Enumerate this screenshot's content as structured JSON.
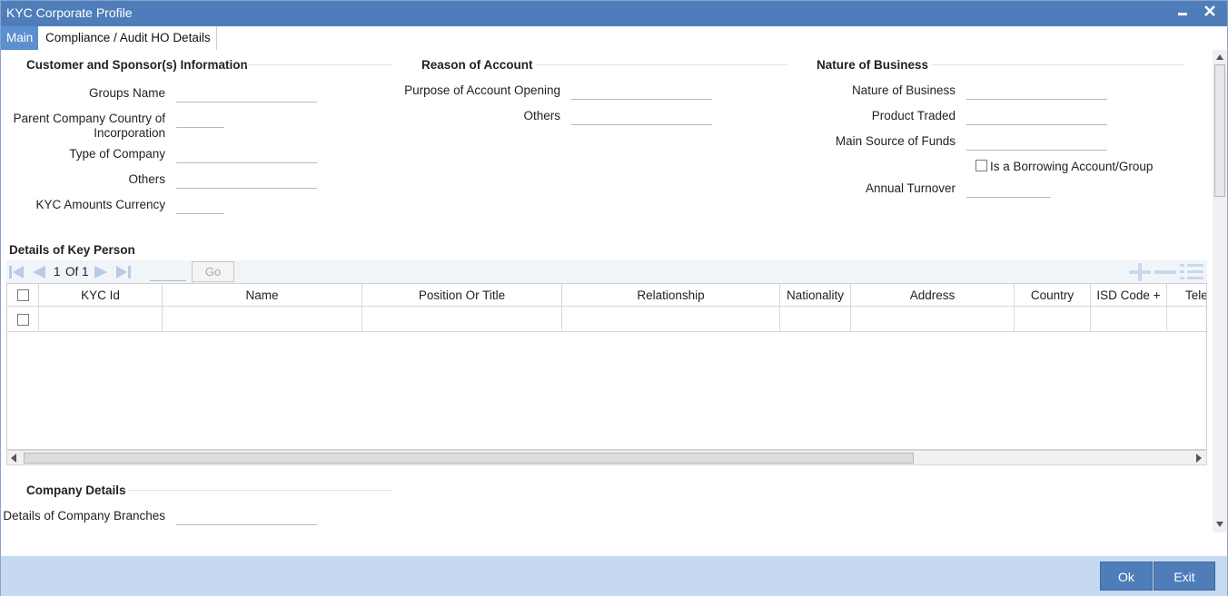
{
  "window": {
    "title": "KYC Corporate Profile",
    "minimize_glyph": "▬",
    "close_glyph": "✕"
  },
  "tabs": [
    {
      "label": "Main",
      "active": true
    },
    {
      "label": "Compliance / Audit HO Details",
      "active": false
    }
  ],
  "customer_section": {
    "heading": "Customer and Sponsor(s) Information",
    "groups_name": {
      "label": "Groups Name",
      "value": ""
    },
    "parent_country": {
      "label_line1": "Parent Company Country of",
      "label_line2": "Incorporation",
      "value": ""
    },
    "type_of_company": {
      "label": "Type of Company",
      "value": ""
    },
    "others": {
      "label": "Others",
      "value": ""
    },
    "kyc_currency": {
      "label": "KYC Amounts Currency",
      "value": ""
    }
  },
  "reason_section": {
    "heading": "Reason of Account",
    "purpose": {
      "label": "Purpose of Account Opening",
      "value": ""
    },
    "others": {
      "label": "Others",
      "value": ""
    }
  },
  "business_section": {
    "heading": "Nature of Business",
    "nature": {
      "label": "Nature of Business",
      "value": ""
    },
    "product_traded": {
      "label": "Product Traded",
      "value": ""
    },
    "main_source": {
      "label": "Main Source of Funds",
      "value": ""
    },
    "borrowing": {
      "label": "Is a Borrowing Account/Group",
      "checked": false
    },
    "annual_turnover": {
      "label": "Annual Turnover",
      "value": ""
    }
  },
  "key_person": {
    "heading": "Details of Key Person",
    "pager": {
      "current": "1",
      "of_label": "Of",
      "total": "1",
      "go_label": "Go",
      "page_input": ""
    },
    "columns": [
      "KYC Id",
      "Name",
      "Position Or Title",
      "Relationship",
      "Nationality",
      "Address",
      "Country",
      "ISD Code +",
      "Tele"
    ],
    "rows": [
      {
        "checked": false,
        "cells": [
          "",
          "",
          "",
          "",
          "",
          "",
          "",
          "",
          ""
        ]
      }
    ]
  },
  "company_section": {
    "heading": "Company Details",
    "branches": {
      "label": "Details of Company Branches",
      "value": ""
    }
  },
  "footer": {
    "ok_label": "Ok",
    "exit_label": "Exit"
  },
  "colors": {
    "titlebar": "#4f7dba",
    "active_tab": "#5b8fd0",
    "footer": "#c5daf1",
    "button": "#4f7dba"
  }
}
